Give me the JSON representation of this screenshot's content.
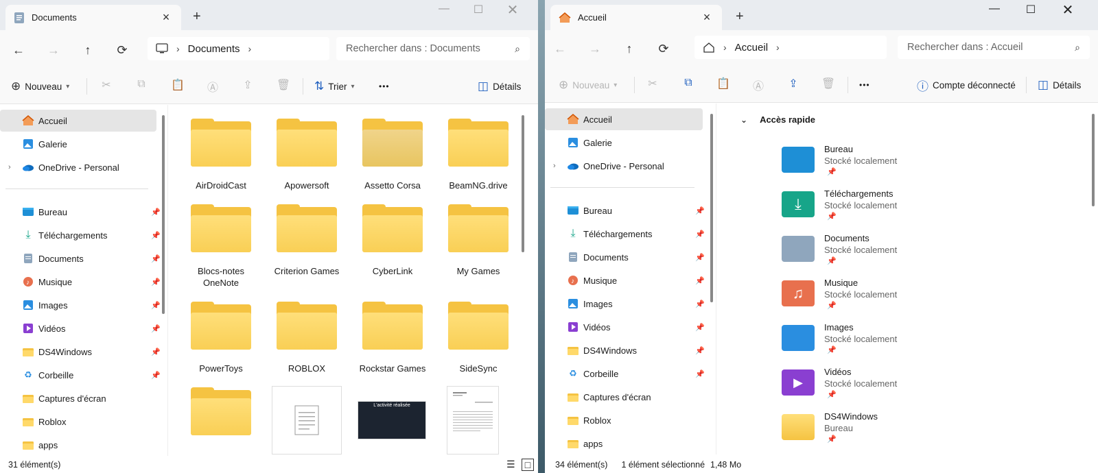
{
  "left": {
    "tab_title": "Documents",
    "breadcrumb": [
      "Documents"
    ],
    "search_placeholder": "Rechercher dans : Documents",
    "toolbar": {
      "new": "Nouveau",
      "sort": "Trier",
      "details": "Détails",
      "more": "•••"
    },
    "sidebar_top": [
      "Accueil",
      "Galerie",
      "OneDrive - Personal"
    ],
    "sidebar_pinned": [
      "Bureau",
      "Téléchargements",
      "Documents",
      "Musique",
      "Images",
      "Vidéos",
      "DS4Windows",
      "Corbeille"
    ],
    "sidebar_other": [
      "Captures d'écran",
      "Roblox",
      "apps"
    ],
    "folders": [
      "AirDroidCast",
      "Apowersoft",
      "Assetto Corsa",
      "BeamNG.drive",
      "Blocs-notes OneNote",
      "Criterion Games",
      "CyberLink",
      "My Games",
      "PowerToys",
      "ROBLOX",
      "Rockstar Games",
      "SideSync"
    ],
    "thumb_text": "L'activité réalisée",
    "status": "31 élément(s)"
  },
  "right": {
    "tab_title": "Accueil",
    "breadcrumb": [
      "Accueil"
    ],
    "search_placeholder": "Rechercher dans : Accueil",
    "toolbar": {
      "new": "Nouveau",
      "account": "Compte déconnecté",
      "details": "Détails",
      "more": "•••"
    },
    "sidebar_top": [
      "Accueil",
      "Galerie",
      "OneDrive - Personal"
    ],
    "sidebar_pinned": [
      "Bureau",
      "Téléchargements",
      "Documents",
      "Musique",
      "Images",
      "Vidéos",
      "DS4Windows",
      "Corbeille"
    ],
    "sidebar_other": [
      "Captures d'écran",
      "Roblox",
      "apps"
    ],
    "quick_access_title": "Accès rapide",
    "quick_access": [
      {
        "name": "Bureau",
        "sub": "Stocké localement",
        "color": "#1e8fd6"
      },
      {
        "name": "Téléchargements",
        "sub": "Stocké localement",
        "color": "#17a589"
      },
      {
        "name": "Documents",
        "sub": "Stocké localement",
        "color": "#8fa6bd"
      },
      {
        "name": "Musique",
        "sub": "Stocké localement",
        "color": "#e8704e"
      },
      {
        "name": "Images",
        "sub": "Stocké localement",
        "color": "#2a8ee0"
      },
      {
        "name": "Vidéos",
        "sub": "Stocké localement",
        "color": "#8a3fd1"
      },
      {
        "name": "DS4Windows",
        "sub": "Bureau",
        "color": "#f5c342"
      }
    ],
    "status_count": "34 élément(s)",
    "status_selection": "1 élément sélectionné",
    "status_size": "1,48 Mo"
  }
}
